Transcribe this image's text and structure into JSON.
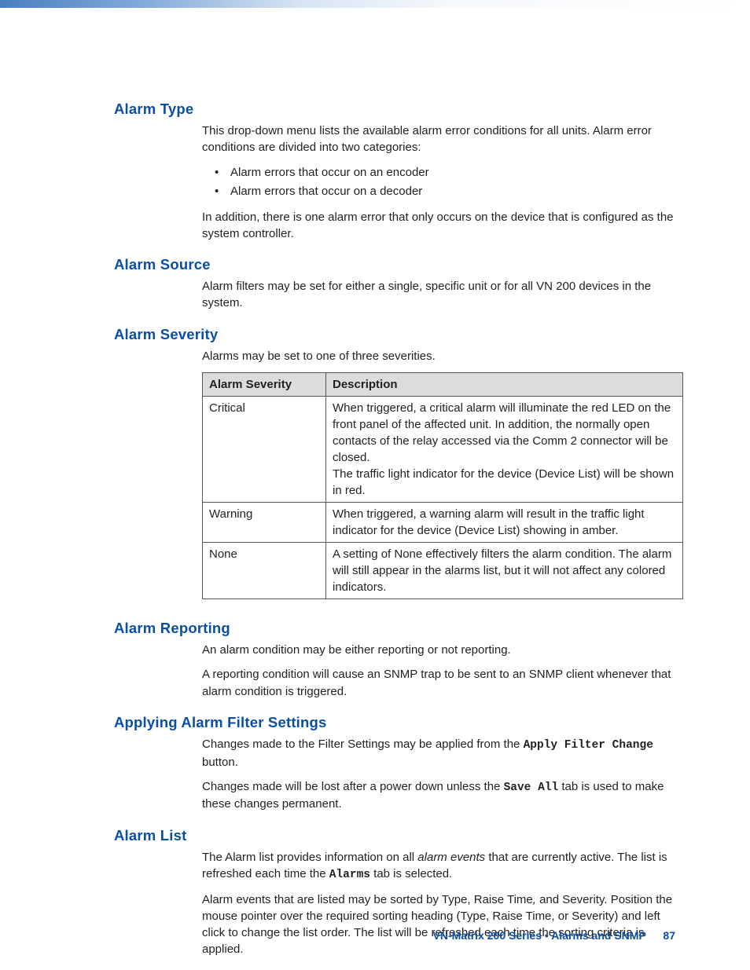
{
  "sections": {
    "alarm_type": {
      "heading": "Alarm Type",
      "p1": "This drop-down menu lists the available alarm error conditions for all units. Alarm error conditions are divided into two categories:",
      "bullet1": "Alarm errors that occur on an encoder",
      "bullet2": "Alarm errors that occur on a decoder",
      "p2": "In addition, there is one alarm error that only occurs on the device that is configured as the system controller."
    },
    "alarm_source": {
      "heading": "Alarm Source",
      "p1": "Alarm filters may be set for either a single, specific unit or for all VN 200 devices in the system."
    },
    "alarm_severity": {
      "heading": "Alarm Severity",
      "p1": "Alarms may be set to one of three severities.",
      "table": {
        "head_col1": "Alarm Severity",
        "head_col2": "Description",
        "rows": [
          {
            "severity": "Critical",
            "desc_line1": "When triggered, a critical alarm will illuminate the red LED on the front panel of the affected unit. In addition, the normally open contacts of the relay accessed via the Comm 2 connector will be closed.",
            "desc_line2": "The traffic light indicator for the device (Device List) will be shown in red."
          },
          {
            "severity": "Warning",
            "desc_line1": "When triggered, a warning alarm will result in the traffic light indicator for the device (Device List) showing in amber.",
            "desc_line2": ""
          },
          {
            "severity": "None",
            "desc_line1": "A setting of None effectively filters the alarm condition. The alarm will still appear in the alarms list, but it will not affect any colored indicators.",
            "desc_line2": ""
          }
        ]
      }
    },
    "alarm_reporting": {
      "heading": "Alarm Reporting",
      "p1": "An alarm condition may be either reporting or not reporting.",
      "p2": "A reporting condition will cause an SNMP trap to be sent to an SNMP client whenever that alarm condition is triggered."
    },
    "applying_filter": {
      "heading": "Applying Alarm Filter Settings",
      "p1_pre": "Changes made to the Filter Settings may be applied from the ",
      "p1_mono": "Apply Filter Change",
      "p1_post": " button.",
      "p2_pre": "Changes made will be lost after a power down unless the ",
      "p2_mono": "Save All",
      "p2_post": " tab is used to make these changes permanent."
    },
    "alarm_list": {
      "heading": "Alarm List",
      "p1_pre": "The Alarm list provides information on all ",
      "p1_em": "alarm events",
      "p1_mid": " that are currently active. The list is refreshed each time the ",
      "p1_mono": "Alarms",
      "p1_post": " tab is selected.",
      "p2_pre": "Alarm events that are listed may be sorted by Type, Raise Time",
      "p2_em": ",",
      "p2_post": " and Severity. Position the mouse pointer over the required sorting heading (Type, Raise Time, or Severity) and left click to change the list order. The list will be refreshed each time the sorting criteria is applied."
    }
  },
  "footer": {
    "text": "VN-Matrix 200 Series  •  Alarms and SNMP",
    "page": "87"
  }
}
